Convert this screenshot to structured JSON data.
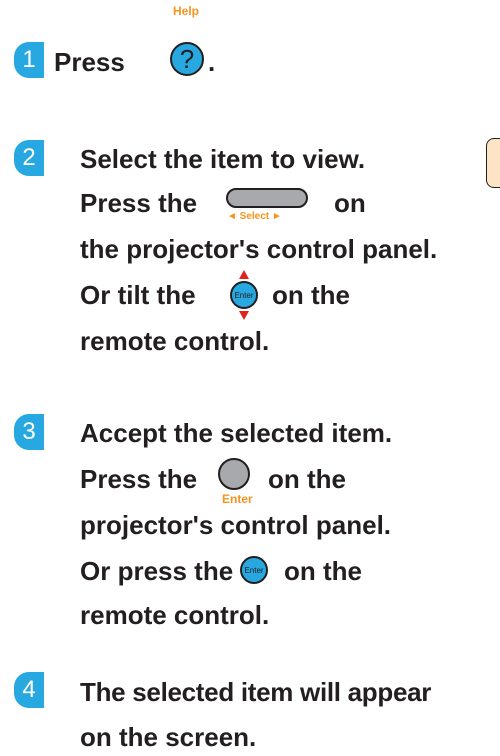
{
  "step1": {
    "number": "1",
    "help_label": "Help",
    "text_press": "Press",
    "help_icon_glyph": "?",
    "period": "."
  },
  "step2": {
    "number": "2",
    "line1": "Select the item to view.",
    "line2_start": "Press the",
    "line2_end": "on",
    "select_label": "◄ Select ►",
    "line3": "the projector's control panel.",
    "line4_start": "Or tilt the",
    "enter_label": "Enter",
    "line4_end": "on the",
    "line5": "remote control."
  },
  "step3": {
    "number": "3",
    "line1": "Accept the selected item.",
    "line2_start": "Press the",
    "line2_end": "on the",
    "enter_label": "Enter",
    "line3": "projector's control panel.",
    "line4_start": "Or press the",
    "enter_button_label": "Enter",
    "line4_end": "on the",
    "line5": "remote control."
  },
  "step4": {
    "number": "4",
    "line1": "The selected item will appear",
    "line2": "on the screen."
  },
  "colors": {
    "accent_blue": "#27a8e0",
    "label_orange": "#f7941d",
    "arrow_red": "#e2231a",
    "button_gray": "#a7a9ac"
  }
}
